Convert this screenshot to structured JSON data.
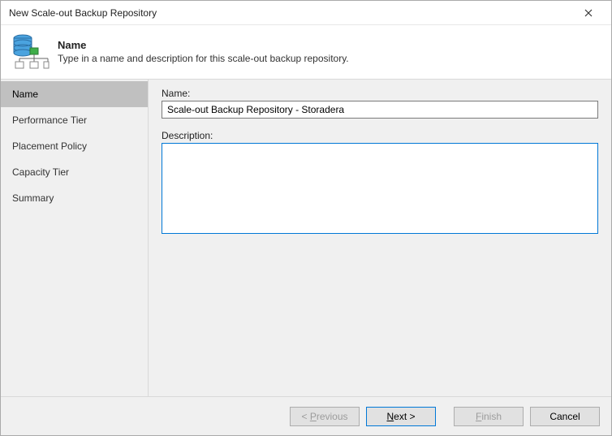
{
  "window": {
    "title": "New Scale-out Backup Repository"
  },
  "header": {
    "heading": "Name",
    "sub": "Type in a name and description for this scale-out backup repository."
  },
  "sidebar": {
    "items": [
      {
        "label": "Name",
        "active": true
      },
      {
        "label": "Performance Tier",
        "active": false
      },
      {
        "label": "Placement Policy",
        "active": false
      },
      {
        "label": "Capacity Tier",
        "active": false
      },
      {
        "label": "Summary",
        "active": false
      }
    ]
  },
  "form": {
    "name_label": "Name:",
    "name_value": "Scale-out Backup Repository - Storadera",
    "description_label": "Description:",
    "description_value": ""
  },
  "buttons": {
    "previous_prefix": "< ",
    "previous_u": "P",
    "previous_rest": "revious",
    "next_u": "N",
    "next_rest": "ext >",
    "finish_u": "F",
    "finish_rest": "inish",
    "cancel": "Cancel"
  }
}
